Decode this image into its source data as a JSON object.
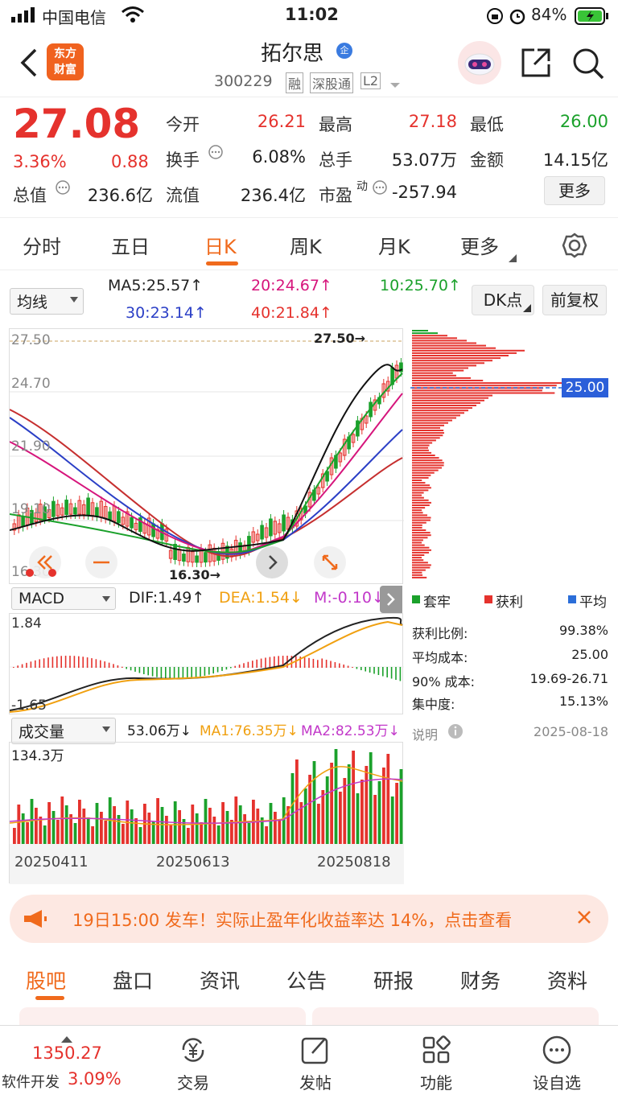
{
  "status": {
    "carrier": "中国电信",
    "time": "11:02",
    "battery": "84%"
  },
  "nav": {
    "stock_name": "拓尔思",
    "badge": "企",
    "code": "300229",
    "tag1": "融",
    "tag2": "深股通",
    "tag3": "L2",
    "logo_line1": "东方",
    "logo_line2": "财富"
  },
  "quote": {
    "price": "27.08",
    "change_pct": "3.36%",
    "change": "0.88",
    "open_label": "今开",
    "open": "26.21",
    "high_label": "最高",
    "high": "27.18",
    "low_label": "最低",
    "low": "26.00",
    "turnover_label": "换手",
    "turnover": "6.08%",
    "volume_label": "总手",
    "volume": "53.07万",
    "amount_label": "金额",
    "amount": "14.15亿",
    "mcap_label": "总值",
    "mcap": "236.6亿",
    "float_label": "流值",
    "float": "236.4亿",
    "pe_label": "市盈",
    "pe_sup": "动",
    "pe": "-257.94",
    "more": "更多"
  },
  "tabs": [
    "分时",
    "五日",
    "日K",
    "周K",
    "月K",
    "更多"
  ],
  "ma_bar": {
    "selector": "均线",
    "ma5": "MA5:25.57↑",
    "ma10": "10:25.70↑",
    "ma20": "20:24.67↑",
    "ma30": "30:23.14↑",
    "ma40": "40:21.84↑",
    "dk": "DK点",
    "adjust": "前复权"
  },
  "kchart": {
    "y_ticks": [
      "27.50",
      "24.70",
      "21.90",
      "19.10",
      "16.30"
    ],
    "max_label": "27.50",
    "min_label": "16.30",
    "chip_price": "25.00"
  },
  "macd": {
    "selector": "MACD",
    "dif": "DIF:1.49↑",
    "dea": "DEA:1.54↓",
    "m": "M:-0.10↓",
    "top": "1.84",
    "bottom": "-1.65"
  },
  "volume": {
    "selector": "成交量",
    "v": "53.06万↓",
    "ma1": "MA1:76.35万↓",
    "ma2": "MA2:82.53万↓",
    "top": "134.3万",
    "dates": [
      "20250411",
      "20250613",
      "20250818"
    ]
  },
  "chips": {
    "legend": [
      "套牢",
      "获利",
      "平均"
    ],
    "rows": [
      {
        "label": "获利比例:",
        "value": "99.38%"
      },
      {
        "label": "平均成本:",
        "value": "25.00"
      },
      {
        "label": "90% 成本:",
        "value": "19.69-26.71"
      },
      {
        "label": "集中度:",
        "value": "15.13%"
      }
    ],
    "note": "说明",
    "date": "2025-08-18"
  },
  "banner": {
    "text": "19日15:00 发车！实际止盈年化收益率达 14%，点击查看"
  },
  "bottom_tabs": [
    "股吧",
    "盘口",
    "资讯",
    "公告",
    "研报",
    "财务",
    "资料"
  ],
  "toolbar": {
    "index_value": "1350.27",
    "index_name": "软件开发",
    "index_pct": "3.09%",
    "items": [
      "交易",
      "发帖",
      "功能",
      "设自选"
    ]
  },
  "colors": {
    "up": "#e5322d",
    "down": "#1ba12b",
    "accent": "#f06a1c"
  }
}
